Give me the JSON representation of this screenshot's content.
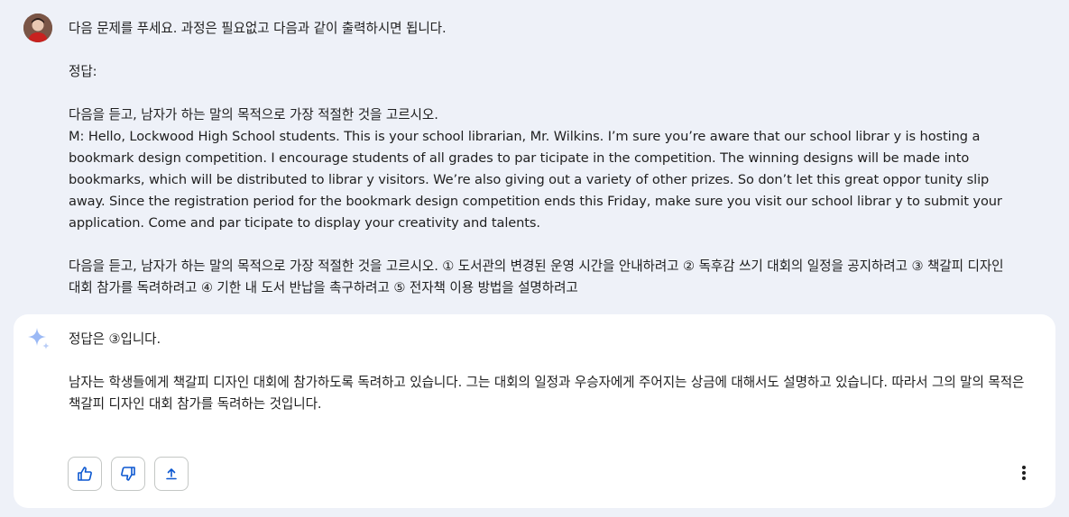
{
  "user_message": {
    "paragraphs": [
      "다음 문제를 푸세요. 과정은 필요없고 다음과 같이 출력하시면 됩니다.",
      "정답:",
      "다음을 듣고, 남자가 하는 말의 목적으로 가장 적절한 것을 고르시오.",
      "M: Hello, Lockwood High School students. This is your school librarian, Mr. Wilkins. I’m sure you’re aware that our school librar y is hosting a bookmark design competition. I encourage students of all grades to par ticipate in the competition. The winning designs will be made into bookmarks, which will be distributed to librar y visitors. We’re also giving out a variety of other prizes. So don’t let this great oppor tunity slip away. Since the registration period for the bookmark design competition ends this Friday, make sure you visit our school librar y to submit your application. Come and par ticipate to display your creativity and talents.",
      "다음을 듣고, 남자가 하는 말의 목적으로 가장 적절한 것을 고르시오. ① 도서관의 변경된 운영 시간을 안내하려고 ② 독후감 쓰기 대회의 일정을 공지하려고 ③ 책갈피 디자인 대회 참가를 독려하려고 ④ 기한 내 도서 반납을 촉구하려고 ⑤ 전자책 이용 방법을 설명하려고"
    ]
  },
  "response": {
    "paragraphs": [
      "정답은 ③입니다.",
      "남자는 학생들에게 책갈피 디자인 대회에 참가하도록 독려하고 있습니다. 그는 대회의 일정과 우승자에게 주어지는 상금에 대해서도 설명하고 있습니다. 따라서 그의 말의 목적은 책갈피 디자인 대회 참가를 독려하는 것입니다."
    ]
  },
  "actions": {
    "icons": [
      "thumb-up-icon",
      "thumb-down-icon",
      "share-icon",
      "more-vert-icon"
    ]
  },
  "colors": {
    "page_background": "#eef1f8",
    "card_background": "#ffffff",
    "accent": "#0b57d0",
    "sparkle": "#9bb9f5",
    "text": "#1f1f1f"
  }
}
